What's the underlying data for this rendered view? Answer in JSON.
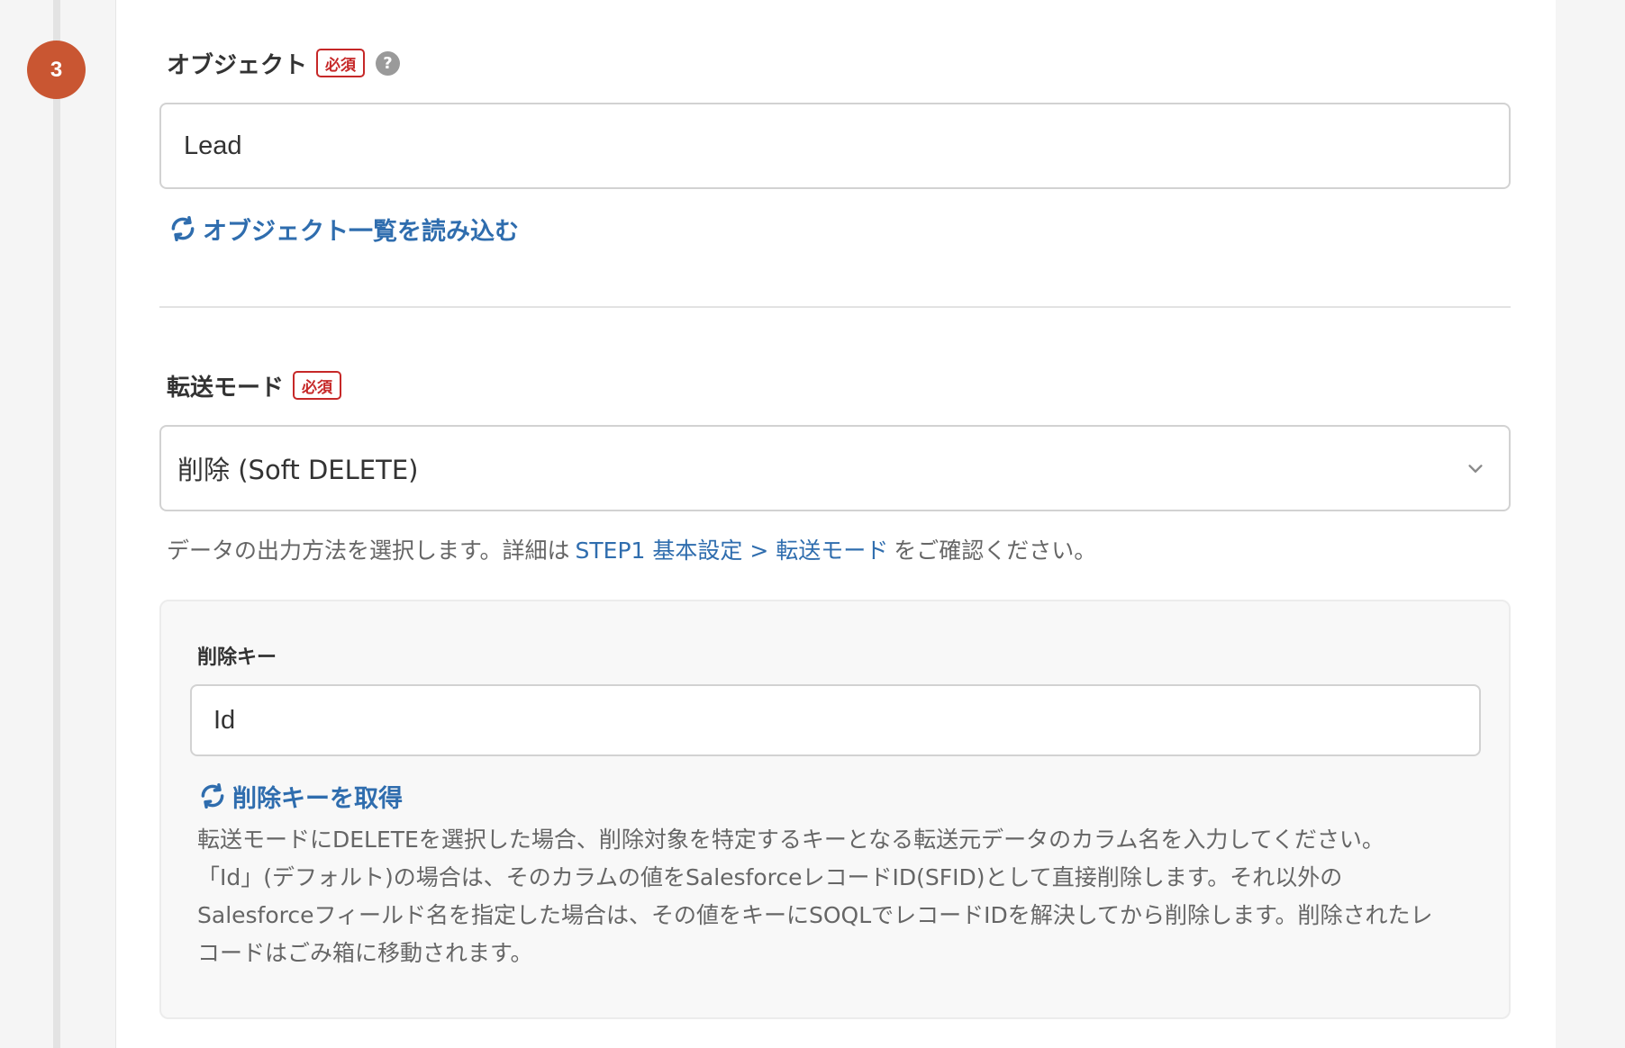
{
  "step": {
    "number": "3"
  },
  "object_field": {
    "label": "オブジェクト",
    "required_badge": "必須",
    "help_icon": "?",
    "value": "Lead",
    "load_link": "オブジェクト一覧を読み込む"
  },
  "transfer_mode": {
    "label": "転送モード",
    "required_badge": "必須",
    "selected": "削除 (Soft DELETE)",
    "help_prefix": "データの出力方法を選択します。詳細は",
    "help_link": "STEP1 基本設定 > 転送モード",
    "help_suffix": "をご確認ください。"
  },
  "delete_key": {
    "label": "削除キー",
    "value": "Id",
    "fetch_link": "削除キーを取得",
    "description_lines": [
      "転送モードにDELETEを選択した場合、削除対象を特定するキーとなる転送元データのカラム名を入力してください。",
      "「Id」(デフォルト)の場合は、そのカラムの値をSalesforceレコードID(SFID)として直接削除します。それ以外の",
      "Salesforceフィールド名を指定した場合は、その値をキーにSOQLでレコードIDを解決してから削除します。削除されたレ",
      "コードはごみ箱に移動されます。"
    ]
  },
  "icons": {
    "refresh": "refresh-icon",
    "help": "help-icon",
    "chevron": "chevron-down-icon"
  },
  "colors": {
    "step_badge": "#c95632",
    "required": "#c62828",
    "link": "#2f6dae",
    "help_icon": "#9a9a9a"
  }
}
